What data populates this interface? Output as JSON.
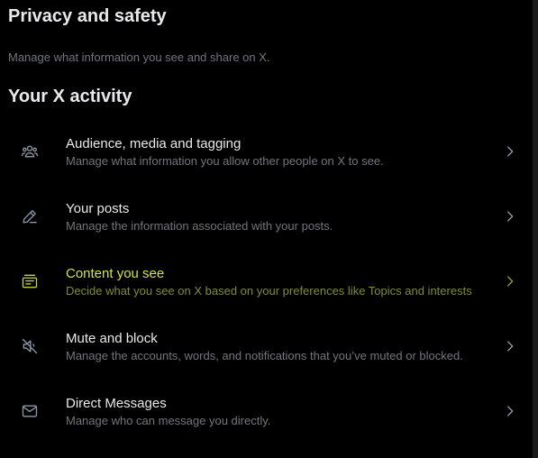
{
  "header": {
    "title": "Privacy and safety",
    "subtitle": "Manage what information you see and share on X."
  },
  "section": {
    "title": "Your X activity"
  },
  "colors": {
    "background": "#000000",
    "primary_text": "#e7e9ea",
    "secondary_text": "#71767b",
    "active_text": "#d4e04a",
    "active_secondary_text": "#7f8a3a"
  },
  "items": [
    {
      "title": "Audience, media and tagging",
      "description": "Manage what information you allow other people on X to see.",
      "icon": "people-icon",
      "active": false
    },
    {
      "title": "Your posts",
      "description": "Manage the information associated with your posts.",
      "icon": "pencil-icon",
      "active": false
    },
    {
      "title": "Content you see",
      "description": "Decide what you see on X based on your preferences like Topics and interests",
      "icon": "content-icon",
      "active": true
    },
    {
      "title": "Mute and block",
      "description": "Manage the accounts, words, and notifications that you’ve muted or blocked.",
      "icon": "mute-icon",
      "active": false
    },
    {
      "title": "Direct Messages",
      "description": "Manage who can message you directly.",
      "icon": "envelope-icon",
      "active": false
    }
  ]
}
